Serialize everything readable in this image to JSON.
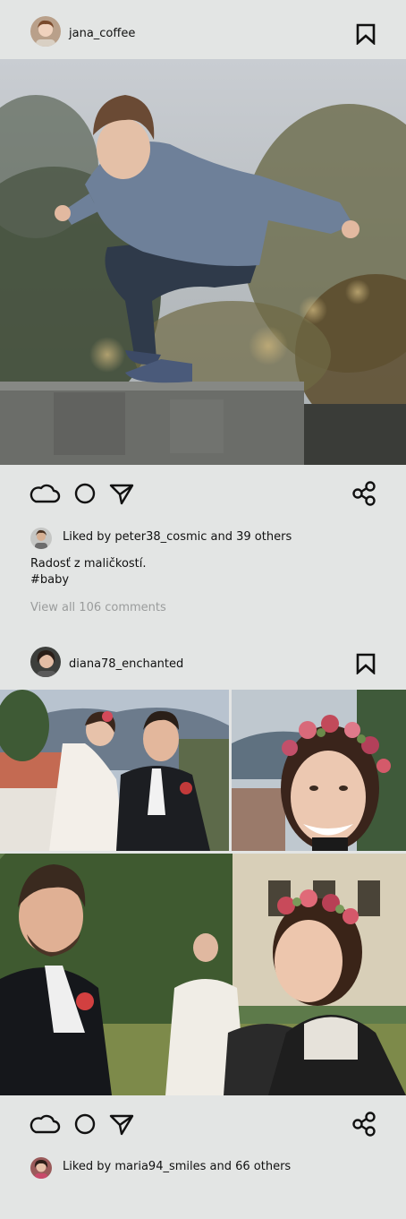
{
  "posts": [
    {
      "username": "jana_coffee",
      "avatar_icon": "user-avatar-boy",
      "media_description": "photo-boy-jumping-off-concrete-wall",
      "actions": {
        "like_icon": "cloud-icon",
        "comment_icon": "circle-icon",
        "send_icon": "paper-plane-icon",
        "share_icon": "share-icon",
        "bookmark_icon": "bookmark-icon"
      },
      "liked_by": "Liked by peter38_cosmic and 39 others",
      "caption_line1": "Radosť z maličkostí.",
      "caption_line2": "#baby",
      "view_comments": "View all 106 comments"
    },
    {
      "username": "diana78_enchanted",
      "avatar_icon": "user-avatar-woman",
      "actions": {
        "like_icon": "cloud-icon",
        "comment_icon": "circle-icon",
        "send_icon": "paper-plane-icon",
        "share_icon": "share-icon",
        "bookmark_icon": "bookmark-icon"
      },
      "liked_by": "Liked by maria94_smiles and 66 others"
    }
  ],
  "colors": {
    "background": "#e3e5e4",
    "muted_text": "#9a9c9c",
    "text": "#111111"
  }
}
